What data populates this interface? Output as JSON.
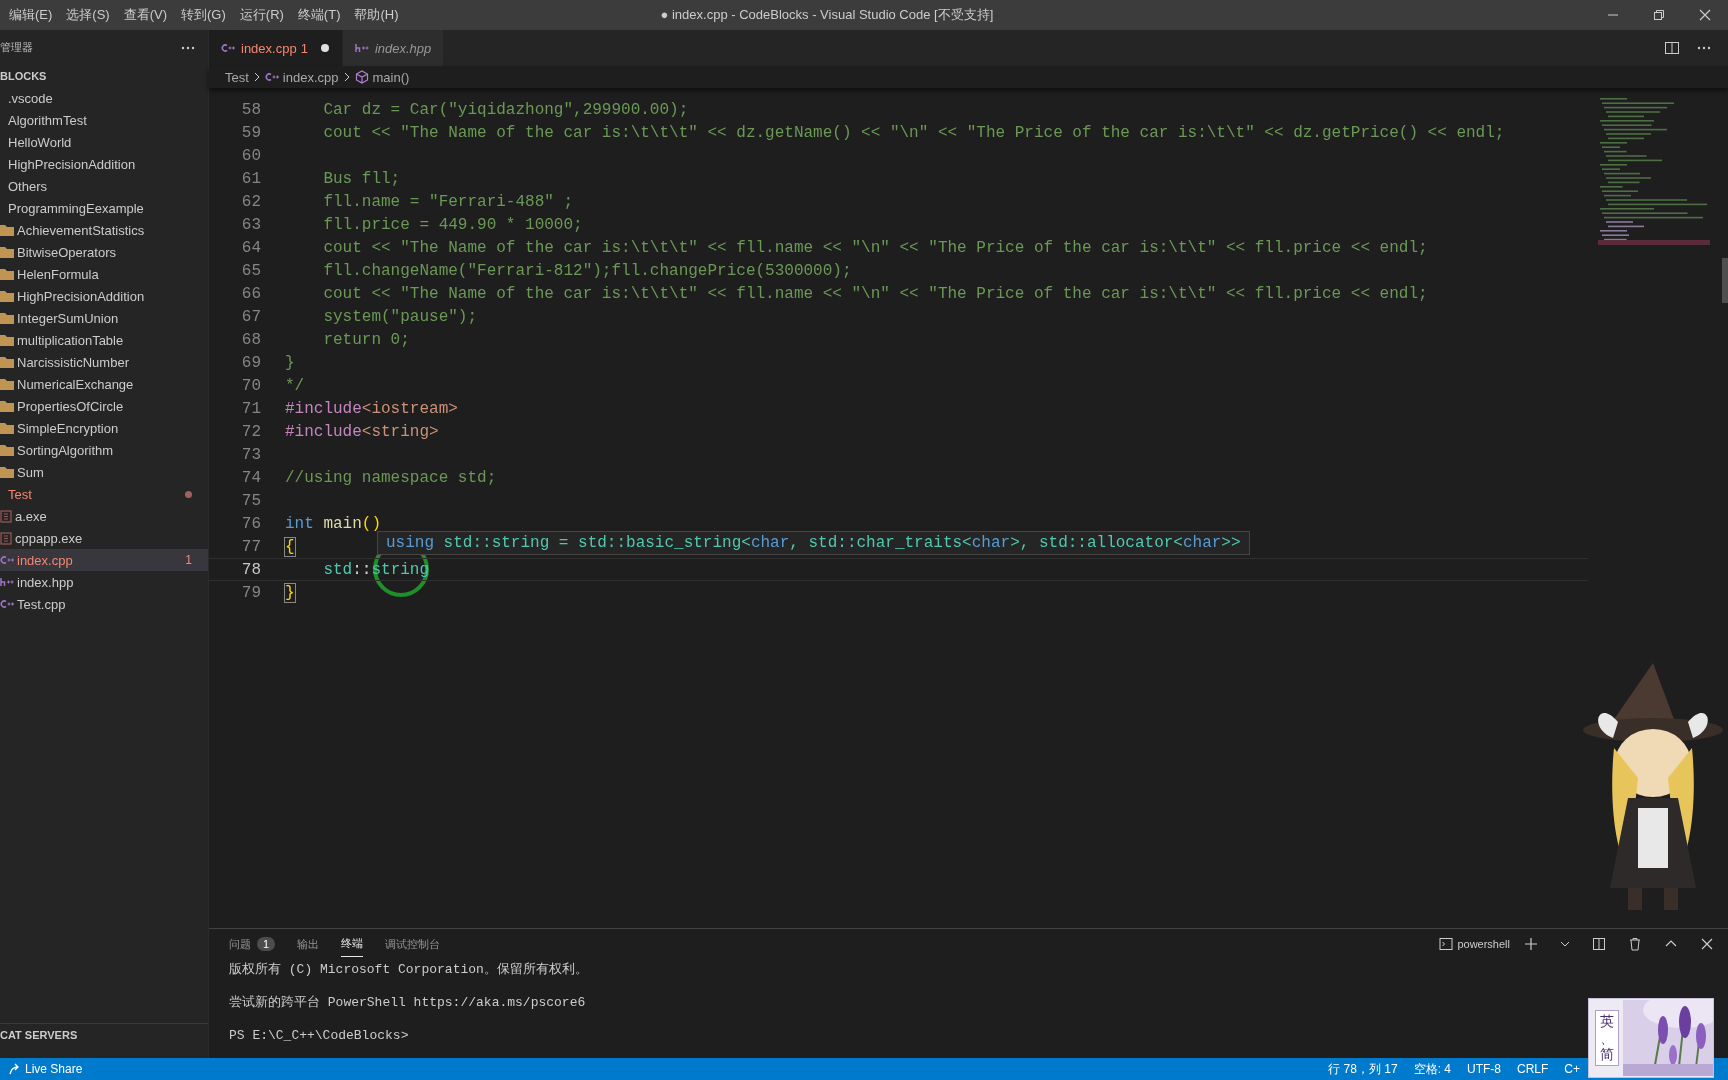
{
  "window": {
    "title": "● index.cpp - CodeBlocks - Visual Studio Code [不受支持]"
  },
  "menu": [
    "编辑(E)",
    "选择(S)",
    "查看(V)",
    "转到(G)",
    "运行(R)",
    "终端(T)",
    "帮助(H)"
  ],
  "sidebar": {
    "title": "管理器",
    "section": "BLOCKS",
    "bottom_section": "CAT SERVERS",
    "items": [
      {
        "label": ".vscode",
        "selected": false,
        "problem": false
      },
      {
        "label": "AlgorithmTest",
        "selected": false,
        "problem": false
      },
      {
        "label": "HelloWorld",
        "selected": false,
        "problem": false
      },
      {
        "label": "HighPrecisionAddition",
        "selected": false,
        "problem": false
      },
      {
        "label": "Others",
        "selected": false,
        "problem": false
      },
      {
        "label": "ProgrammingEexample",
        "selected": false,
        "problem": false,
        "children": [
          {
            "label": "AchievementStatistics",
            "kind": "folder",
            "selected": false,
            "problem": false
          },
          {
            "label": "BitwiseOperators",
            "kind": "folder",
            "selected": false,
            "problem": false
          },
          {
            "label": "HelenFormula",
            "kind": "folder",
            "selected": false,
            "problem": false
          },
          {
            "label": "HighPrecisionAddition",
            "kind": "folder",
            "selected": false,
            "problem": false
          },
          {
            "label": "IntegerSumUnion",
            "kind": "folder",
            "selected": false,
            "problem": false
          },
          {
            "label": "multiplicationTable",
            "kind": "folder",
            "selected": false,
            "problem": false
          },
          {
            "label": "NarcissisticNumber",
            "kind": "folder",
            "selected": false,
            "problem": false
          },
          {
            "label": "NumericalExchange",
            "kind": "folder",
            "selected": false,
            "problem": false
          },
          {
            "label": "PropertiesOfCircle",
            "kind": "folder",
            "selected": false,
            "problem": false
          },
          {
            "label": "SimpleEncryption",
            "kind": "folder",
            "selected": false,
            "problem": false
          },
          {
            "label": "SortingAlgorithm",
            "kind": "folder",
            "selected": false,
            "problem": false
          },
          {
            "label": "Sum",
            "kind": "folder",
            "selected": false,
            "problem": false
          }
        ]
      },
      {
        "label": "Test",
        "selected": false,
        "problem": true,
        "children": [
          {
            "label": "a.exe",
            "kind": "exe",
            "selected": false,
            "problem": false
          },
          {
            "label": "cppapp.exe",
            "kind": "exe",
            "selected": false,
            "problem": false
          },
          {
            "label": "index.cpp",
            "kind": "cpp",
            "selected": true,
            "problem": true,
            "badge": "1"
          },
          {
            "label": "index.hpp",
            "kind": "hpp",
            "selected": false,
            "problem": false
          },
          {
            "label": "Test.cpp",
            "kind": "cpp",
            "selected": false,
            "problem": false
          }
        ]
      }
    ]
  },
  "tabs": [
    {
      "label": "index.cpp",
      "kind": "cpp",
      "badge": "1",
      "selected": true,
      "modified": true,
      "preview": false,
      "problem": true
    },
    {
      "label": "index.hpp",
      "kind": "hpp",
      "selected": false,
      "modified": false,
      "preview": true,
      "problem": false
    }
  ],
  "breadcrumbs": [
    {
      "label": "Test"
    },
    {
      "label": "index.cpp",
      "kind": "cpp"
    },
    {
      "label": "main()",
      "kind": "function"
    }
  ],
  "editor": {
    "lines": [
      {
        "number": "58",
        "current": false,
        "tokens": [
          {
            "text": "    Car dz = Car(\"yiqidazhong\",299900.00);",
            "kind": "comment"
          }
        ]
      },
      {
        "number": "59",
        "current": false,
        "tokens": [
          {
            "text": "    cout << \"The Name of the car is:\\t\\t\\t\" << dz.getName() << \"\\n\" << \"The Price of the car is:\\t\\t\" << dz.getPrice() << endl;",
            "kind": "comment"
          }
        ]
      },
      {
        "number": "60",
        "current": false
      },
      {
        "number": "61",
        "current": false,
        "tokens": [
          {
            "text": "    Bus fll;",
            "kind": "comment"
          }
        ]
      },
      {
        "number": "62",
        "current": false,
        "tokens": [
          {
            "text": "    fll.name = \"Ferrari-488\" ;",
            "kind": "comment"
          }
        ]
      },
      {
        "number": "63",
        "current": false,
        "tokens": [
          {
            "text": "    fll.price = 449.90 * 10000;",
            "kind": "comment"
          }
        ]
      },
      {
        "number": "64",
        "current": false,
        "tokens": [
          {
            "text": "    cout << \"The Name of the car is:\\t\\t\\t\" << fll.name << \"\\n\" << \"The Price of the car is:\\t\\t\" << fll.price << endl;",
            "kind": "comment"
          }
        ]
      },
      {
        "number": "65",
        "current": false,
        "tokens": [
          {
            "text": "    fll.changeName(\"Ferrari-812\");fll.changePrice(5300000);",
            "kind": "comment"
          }
        ]
      },
      {
        "number": "66",
        "current": false,
        "tokens": [
          {
            "text": "    cout << \"The Name of the car is:\\t\\t\\t\" << fll.name << \"\\n\" << \"The Price of the car is:\\t\\t\" << fll.price << endl;",
            "kind": "comment"
          }
        ]
      },
      {
        "number": "67",
        "current": false,
        "tokens": [
          {
            "text": "    system(\"pause\");",
            "kind": "comment"
          }
        ]
      },
      {
        "number": "68",
        "current": false,
        "tokens": [
          {
            "text": "    return 0;",
            "kind": "comment"
          }
        ]
      },
      {
        "number": "69",
        "current": false,
        "tokens": [
          {
            "text": "}",
            "kind": "comment"
          }
        ]
      },
      {
        "number": "70",
        "current": false,
        "tokens": [
          {
            "text": "*/",
            "kind": "comment"
          }
        ]
      },
      {
        "number": "71",
        "current": false,
        "tokens": [
          {
            "text": "#include",
            "kind": "directive"
          },
          {
            "text": "<iostream>",
            "kind": "include"
          }
        ]
      },
      {
        "number": "72",
        "current": false,
        "tokens": [
          {
            "text": "#include",
            "kind": "directive"
          },
          {
            "text": "<string>",
            "kind": "include"
          }
        ]
      },
      {
        "number": "73",
        "current": false
      },
      {
        "number": "74",
        "current": false,
        "tokens": [
          {
            "text": "//using namespace std;",
            "kind": "comment"
          }
        ]
      },
      {
        "number": "75",
        "current": false
      },
      {
        "number": "76",
        "current": false,
        "tokens": [
          {
            "text": "int ",
            "kind": "keyword"
          },
          {
            "text": "main",
            "kind": "function"
          },
          {
            "text": "()",
            "kind": "bracket"
          }
        ]
      },
      {
        "number": "77",
        "current": false,
        "tokens": [
          {
            "text": "{",
            "kind": "bracket-match"
          }
        ]
      },
      {
        "number": "78",
        "current": true,
        "tokens": [
          {
            "text": "    std",
            "kind": "type"
          },
          {
            "text": "::",
            "kind": "plain"
          },
          {
            "text": "string",
            "kind": "type"
          }
        ]
      },
      {
        "number": "79",
        "current": false,
        "tokens": [
          {
            "text": "}",
            "kind": "bracket-match"
          }
        ]
      }
    ],
    "hover": [
      {
        "text": "using",
        "kind": "keyword"
      },
      {
        "text": " std::string = std::basic_string<",
        "kind": "type"
      },
      {
        "text": "char",
        "kind": "keyword"
      },
      {
        "text": ", std::char_traits<",
        "kind": "type"
      },
      {
        "text": "char",
        "kind": "keyword"
      },
      {
        "text": ">, std::allocator<",
        "kind": "type"
      },
      {
        "text": "char",
        "kind": "keyword"
      },
      {
        "text": ">>",
        "kind": "type"
      }
    ]
  },
  "panel": {
    "tabs": [
      {
        "label": "问题",
        "badge": "1",
        "selected": false
      },
      {
        "label": "输出",
        "selected": false
      },
      {
        "label": "终端",
        "selected": true
      },
      {
        "label": "调试控制台",
        "selected": false
      }
    ],
    "terminal_name": "powershell",
    "lines": [
      "版权所有 (C) Microsoft Corporation。保留所有权利。",
      "尝试新的跨平台 PowerShell https://aka.ms/pscore6",
      "PS E:\\C_C++\\CodeBlocks>"
    ]
  },
  "status_bar": {
    "left": "Live Share",
    "right": [
      "行 78，列 17",
      "空格: 4",
      "UTF-8",
      "CRLF",
      "C+"
    ]
  },
  "ime": {
    "chars": [
      "英",
      "、",
      "简"
    ]
  }
}
